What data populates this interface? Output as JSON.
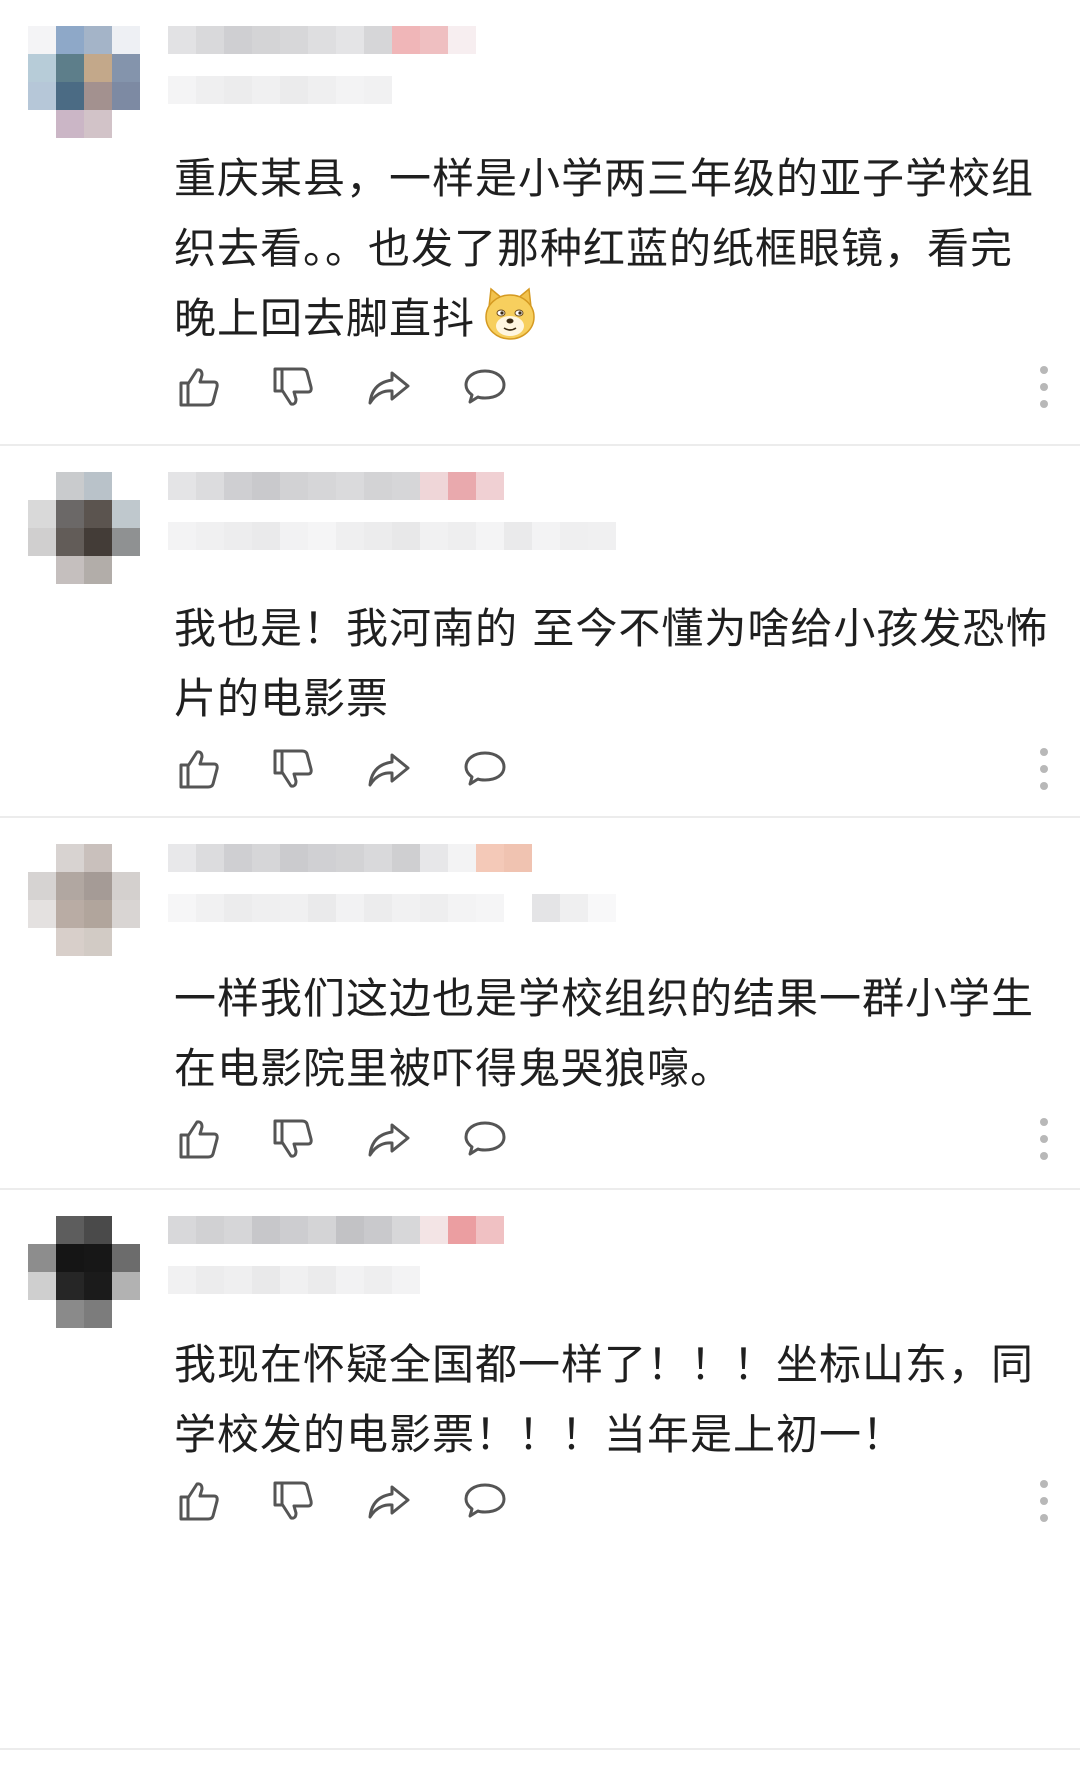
{
  "comments": [
    {
      "text": "重庆某县，一样是小学两三年级的亚子学校组织去看。。也发了那种红蓝的纸框眼镜，看完晚上回去脚直抖",
      "emoji": "doge-emoji",
      "avatar_colors": [
        "#f4f4f6",
        "#8ea8c8",
        "#a4b4c8",
        "#eef0f4",
        "#b7ccd8",
        "#5d7e8a",
        "#c3a88a",
        "#8494ac",
        "#b6c7d8",
        "#4b6b84",
        "#a3918f",
        "#7d8aa3",
        "#ffffff",
        "#cbb6c6",
        "#d2c3c8",
        "#ffffff"
      ]
    },
    {
      "text": "我也是！我河南的 至今不懂为啥给小孩发恐怖片的电影票",
      "avatar_colors": [
        "#ffffff",
        "#c9cbcd",
        "#b9c2c9",
        "#ffffff",
        "#d9d9d9",
        "#6b6867",
        "#5b544f",
        "#bfc8cd",
        "#d0cfcf",
        "#625c58",
        "#433c37",
        "#8f9192",
        "#ffffff",
        "#c5bfbe",
        "#b2ada9",
        "#ffffff"
      ]
    },
    {
      "text": "一样我们这边也是学校组织的结果一群小学生在电影院里被吓得鬼哭狼嚎。",
      "avatar_colors": [
        "#ffffff",
        "#d8d3d1",
        "#c9c0bc",
        "#ffffff",
        "#d6d3d2",
        "#b1a7a1",
        "#a59b96",
        "#d4d0ce",
        "#e4e1e0",
        "#b9aca4",
        "#b1a59c",
        "#d9d5d3",
        "#ffffff",
        "#d8cfca",
        "#d2cbc5",
        "#ffffff"
      ]
    },
    {
      "text": "我现在怀疑全国都一样了！！！坐标山东，同学校发的电影票！！！当年是上初一！",
      "avatar_colors": [
        "#ffffff",
        "#5d5d5d",
        "#4a4a4a",
        "#ffffff",
        "#8d8d8d",
        "#151515",
        "#171717",
        "#6c6c6c",
        "#cfcfcf",
        "#262626",
        "#1b1b1b",
        "#b2b2b2",
        "#ffffff",
        "#8a8a8a",
        "#7c7c7c",
        "#ffffff"
      ]
    }
  ],
  "usernames": [
    {
      "row1": [
        "#e2e2e4",
        "#d9d9db",
        "#cfcfd2",
        "#d4d4d6",
        "#d7d7d9",
        "#dedee0",
        "#e4e4e6",
        "#d6d6d8",
        "#f0b6b8",
        "#efbfc1",
        "#f7eef0"
      ],
      "row2": [
        "#f4f4f5",
        "#efeff0",
        "#ececed",
        "#f0f0f1",
        "#ebebec",
        "#efeff0",
        "#f3f3f4",
        "#f1f1f2"
      ]
    },
    {
      "row1": [
        "#e4e4e6",
        "#dcdcde",
        "#cfcfd2",
        "#c9c9cc",
        "#d2d2d4",
        "#d6d6d8",
        "#dadadc",
        "#d3d3d5",
        "#d6d6d8",
        "#efd6d8",
        "#e9a9ad",
        "#f0d0d3"
      ],
      "row2": [
        "#f3f3f4",
        "#f0f0f1",
        "#ededee",
        "#eaeaeb",
        "#f2f2f3",
        "#f5f5f6",
        "#efeff0",
        "#ececed",
        "#e8e8e9",
        "#f1f1f2",
        "#eeeeef",
        "#f4f4f5",
        "#eaeaeb",
        "#f3f3f4",
        "#efeff0",
        "#f0f0f1"
      ]
    },
    {
      "row1": [
        "#e8e8ea",
        "#dcdcde",
        "#cfcfd2",
        "#d6d6d8",
        "#cbcbce",
        "#d0d0d3",
        "#d3d3d5",
        "#d9d9db",
        "#cfcfd1",
        "#e7e7e9",
        "#f3f3f4",
        "#f4c9b8",
        "#f0c3b1",
        "#ffffff"
      ],
      "row2": [
        "#f6f6f7",
        "#f1f1f2",
        "#ececed",
        "#efeff0",
        "#f0f0f1",
        "#eaeaeb",
        "#f2f2f3",
        "#ececed",
        "#f1f1f2",
        "#eeeeef",
        "#f3f3f4",
        "#f5f5f6",
        "#ffffff",
        "#e4e4e6",
        "#efeff0",
        "#f8f8f9"
      ]
    },
    {
      "row1": [
        "#d8d8da",
        "#d1d1d3",
        "#d6d6d8",
        "#c7c7ca",
        "#cdcdd0",
        "#d4d4d6",
        "#c2c2c5",
        "#c9c9cc",
        "#d7d7d9",
        "#f3e4e5",
        "#eb9ea1",
        "#f0c1c3"
      ],
      "row2": [
        "#f1f1f2",
        "#ececed",
        "#efeff0",
        "#e9e9ea",
        "#f0f0f1",
        "#ebebec",
        "#f2f2f3",
        "#eeeeef",
        "#f3f3f4"
      ]
    }
  ]
}
